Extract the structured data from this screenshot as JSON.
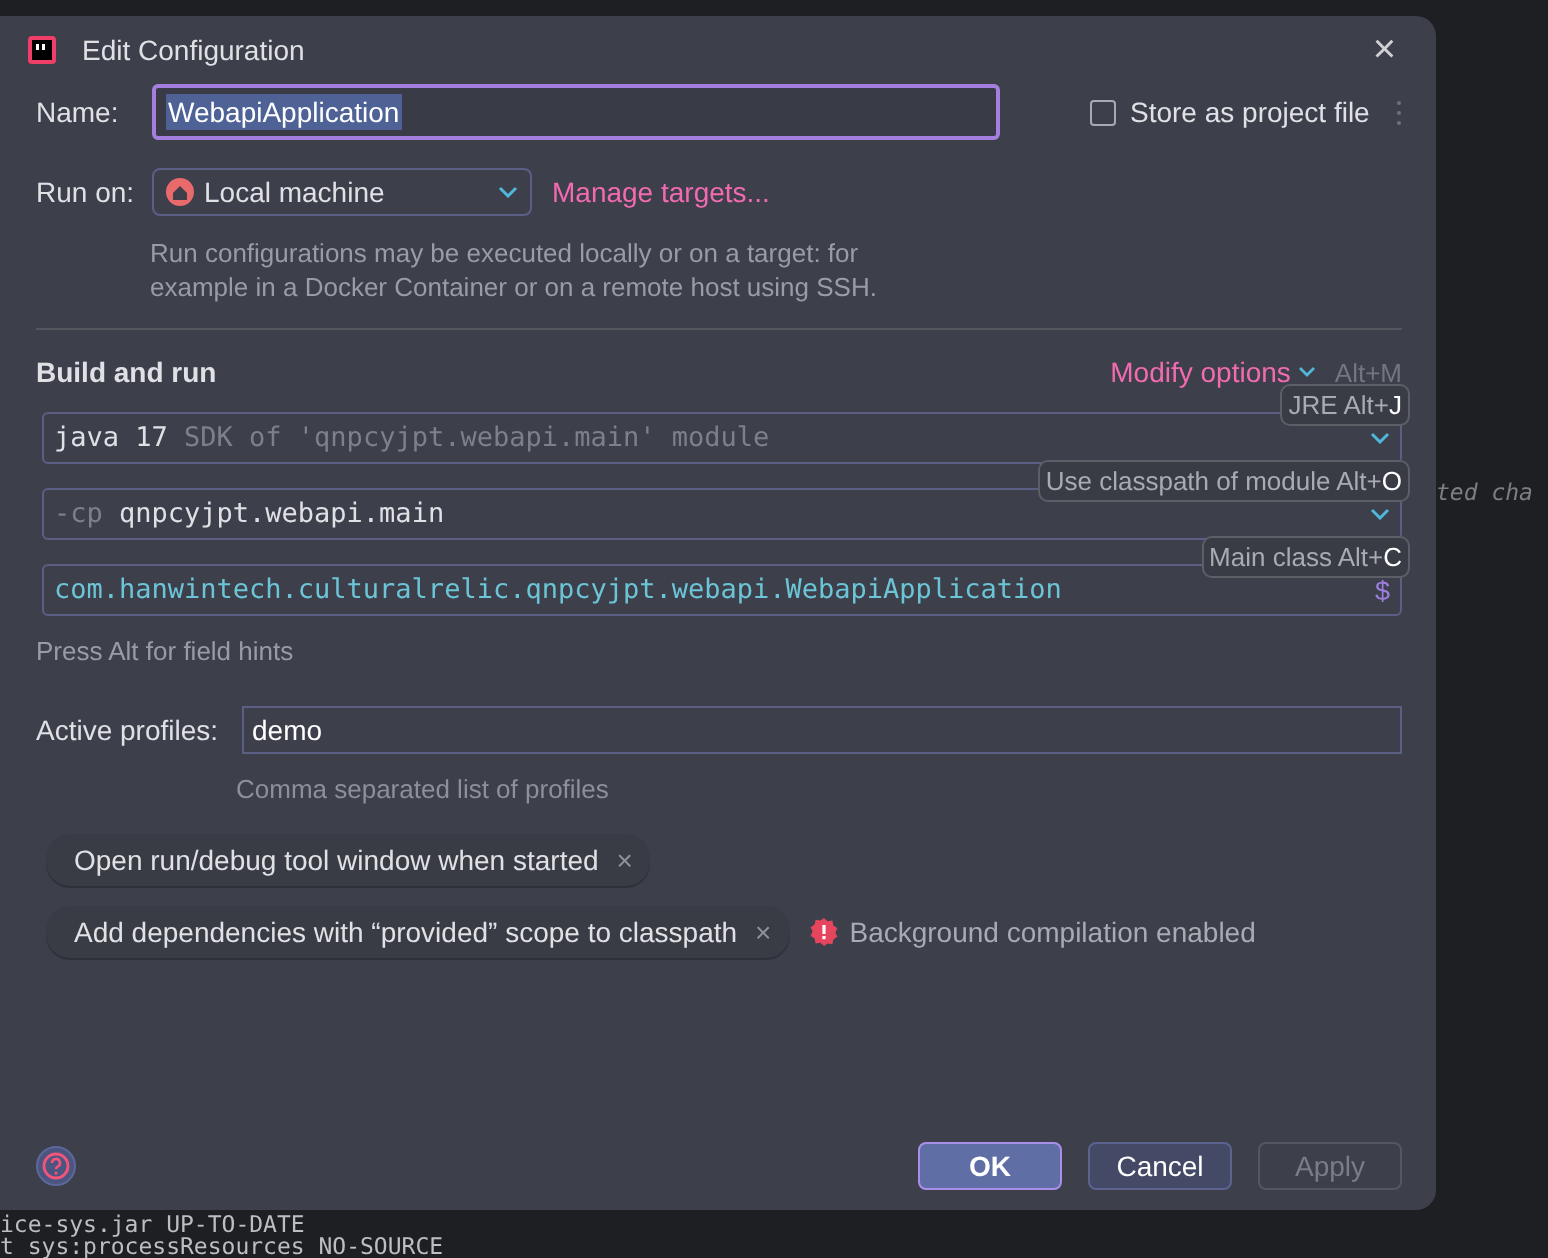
{
  "editor_behind": {
    "lines": [
      {
        "text": "ted cha",
        "kind": "comment"
      },
      {
        "text": "ice-sys.jar UP-TO-DATE",
        "kind": "log"
      },
      {
        "text": "t sys:processResources NO-SOURCE",
        "kind": "log"
      }
    ]
  },
  "window": {
    "title": "Edit Configuration",
    "close": "×"
  },
  "name": {
    "label": "Name:",
    "value": "WebapiApplication",
    "store": {
      "label": "Store as project file",
      "checked": false
    }
  },
  "run_on": {
    "label": "Run on:",
    "value": "Local machine",
    "link": "Manage targets...",
    "description": "Run configurations may be executed locally or on a target: for example in a Docker Container or on a remote host using SSH."
  },
  "build_and_run": {
    "title": "Build and run",
    "modify": "Modify options",
    "modify_shortcut": "Alt+M",
    "fields": [
      {
        "kind": "dropdown",
        "value": "java 17",
        "suffix": "SDK of 'qnpcyjpt.webapi.main' module",
        "hint": "JRE Alt+J"
      },
      {
        "kind": "dropdown",
        "prefix": "-cp",
        "value": "qnpcyjpt.webapi.main",
        "hint": "Use classpath of module Alt+O"
      },
      {
        "kind": "class",
        "value": "com.hanwintech.culturalrelic.qnpcyjpt.webapi.WebapiApplication",
        "hint": "Main class Alt+C",
        "action": "$"
      }
    ],
    "note": "Press Alt for field hints"
  },
  "active_profiles": {
    "label": "Active profiles:",
    "value": "demo",
    "hint": "Comma separated list of profiles"
  },
  "options": [
    {
      "label": "Open run/debug tool window when started",
      "remove": "×"
    },
    {
      "label": "Add dependencies with “provided” scope to classpath",
      "remove": "×"
    }
  ],
  "warning": "Background compilation enabled",
  "buttons": [
    {
      "label": "OK",
      "kind": "primary"
    },
    {
      "label": "Cancel",
      "kind": "normal"
    },
    {
      "label": "Apply",
      "kind": "disabled"
    }
  ]
}
